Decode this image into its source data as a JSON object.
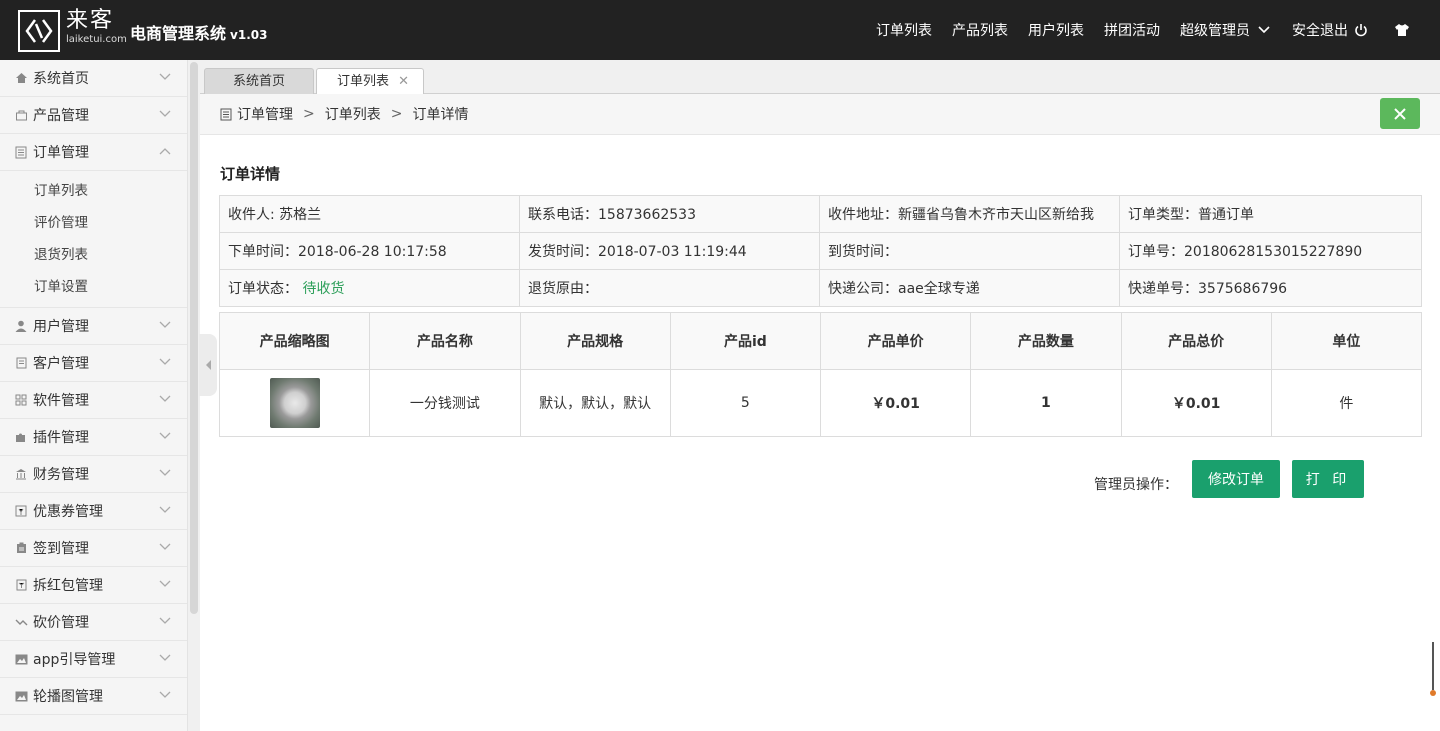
{
  "header": {
    "logo_main": "来客",
    "logo_sub": "laiketui.com",
    "system_title": "电商管理系统",
    "version": "v1.03",
    "nav": [
      "订单列表",
      "产品列表",
      "用户列表",
      "拼团活动"
    ],
    "admin_label": "超级管理员",
    "logout_label": "安全退出"
  },
  "sidebar": {
    "items": [
      {
        "label": "系统首页",
        "icon": "home-icon"
      },
      {
        "label": "产品管理",
        "icon": "bag-icon"
      },
      {
        "label": "订单管理",
        "icon": "list-icon",
        "expanded": true
      },
      {
        "label": "用户管理",
        "icon": "user-icon"
      },
      {
        "label": "客户管理",
        "icon": "document-icon"
      },
      {
        "label": "软件管理",
        "icon": "grid-icon"
      },
      {
        "label": "插件管理",
        "icon": "puzzle-icon"
      },
      {
        "label": "财务管理",
        "icon": "bank-icon"
      },
      {
        "label": "优惠券管理",
        "icon": "coupon-icon"
      },
      {
        "label": "签到管理",
        "icon": "clipboard-icon"
      },
      {
        "label": "拆红包管理",
        "icon": "redpacket-icon"
      },
      {
        "label": "砍价管理",
        "icon": "trend-icon"
      },
      {
        "label": "app引导管理",
        "icon": "image-icon"
      },
      {
        "label": "轮播图管理",
        "icon": "image-icon"
      }
    ],
    "sub_items": [
      "订单列表",
      "评价管理",
      "退货列表",
      "订单设置"
    ]
  },
  "tabs": [
    {
      "label": "系统首页"
    },
    {
      "label": "订单列表"
    }
  ],
  "breadcrumb": [
    "订单管理",
    "订单列表",
    "订单详情"
  ],
  "detail": {
    "title": "订单详情",
    "info_rows": [
      [
        "收件人: 苏格兰",
        "联系电话：15873662533",
        "收件地址：新疆省乌鲁木齐市天山区新给我",
        "订单类型：普通订单"
      ],
      [
        "下单时间：2018-06-28 10:17:58",
        "发货时间：2018-07-03 11:19:44",
        "到货时间：",
        "订单号：20180628153015227890"
      ],
      [
        "",
        "退货原由：",
        "快递公司：aae全球专递",
        "快递单号：3575686796"
      ]
    ],
    "status_label": "订单状态：",
    "status_value": "待收货"
  },
  "products": {
    "headers": [
      "产品缩略图",
      "产品名称",
      "产品规格",
      "产品id",
      "产品单价",
      "产品数量",
      "产品总价",
      "单位"
    ],
    "rows": [
      {
        "name": "一分钱测试",
        "spec": "默认，默认，默认",
        "id": "5",
        "unit_price": "￥0.01",
        "quantity": "1",
        "total": "￥0.01",
        "unit": "件"
      }
    ]
  },
  "operations": {
    "label": "管理员操作：",
    "modify_label": "修改订单",
    "print_label": "打 印"
  },
  "colors": {
    "topbar": "#222222",
    "accent_green": "#1aa06d",
    "close_green": "#5cb85c"
  }
}
